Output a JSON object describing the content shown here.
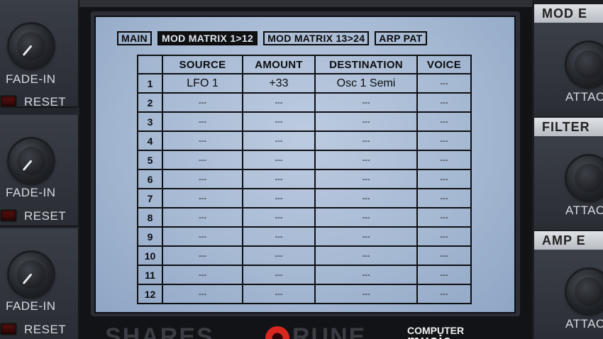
{
  "left_knobs": [
    {
      "label": "FADE-IN",
      "reset_label": "RESET"
    },
    {
      "label": "FADE-IN",
      "reset_label": "RESET"
    },
    {
      "label": "FADE-IN",
      "reset_label": "RESET"
    }
  ],
  "tabs": [
    {
      "label": "MAIN",
      "active": false
    },
    {
      "label": "MOD MATRIX 1>12",
      "active": true
    },
    {
      "label": "MOD MATRIX 13>24",
      "active": false
    },
    {
      "label": "ARP PAT",
      "active": false
    }
  ],
  "matrix": {
    "headers": [
      "",
      "SOURCE",
      "AMOUNT",
      "DESTINATION",
      "VOICE"
    ],
    "rows": [
      {
        "index": "1",
        "source": "LFO 1",
        "amount": "+33",
        "destination": "Osc 1 Semi",
        "voice": "---"
      },
      {
        "index": "2",
        "source": "---",
        "amount": "---",
        "destination": "---",
        "voice": "---"
      },
      {
        "index": "3",
        "source": "---",
        "amount": "---",
        "destination": "---",
        "voice": "---"
      },
      {
        "index": "4",
        "source": "---",
        "amount": "---",
        "destination": "---",
        "voice": "---"
      },
      {
        "index": "5",
        "source": "---",
        "amount": "---",
        "destination": "---",
        "voice": "---"
      },
      {
        "index": "6",
        "source": "---",
        "amount": "---",
        "destination": "---",
        "voice": "---"
      },
      {
        "index": "7",
        "source": "---",
        "amount": "---",
        "destination": "---",
        "voice": "---"
      },
      {
        "index": "8",
        "source": "---",
        "amount": "---",
        "destination": "---",
        "voice": "---"
      },
      {
        "index": "9",
        "source": "---",
        "amount": "---",
        "destination": "---",
        "voice": "---"
      },
      {
        "index": "10",
        "source": "---",
        "amount": "---",
        "destination": "---",
        "voice": "---"
      },
      {
        "index": "11",
        "source": "---",
        "amount": "---",
        "destination": "---",
        "voice": "---"
      },
      {
        "index": "12",
        "source": "---",
        "amount": "---",
        "destination": "---",
        "voice": "---"
      }
    ]
  },
  "right_sections": [
    {
      "header": "MOD E",
      "knob_label": "ATTAC"
    },
    {
      "header": "FILTER",
      "knob_label": "ATTAC"
    },
    {
      "header": "AMP E",
      "knob_label": "ATTAC"
    }
  ],
  "branding": {
    "logo_left": "SHARES",
    "logo_right": "RUNE",
    "cm_top": "COMPUTER",
    "cm_bottom": "music"
  },
  "colors": {
    "screen": "#a6b9d3",
    "active_tab": "#0f1012",
    "reset_led": "#5a1010",
    "logo_accent": "#d8271f"
  }
}
